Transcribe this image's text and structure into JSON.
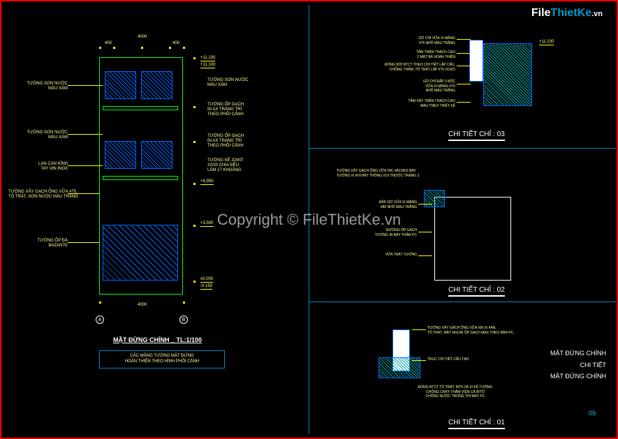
{
  "watermark": {
    "file": "File",
    "thietke": "ThietKe",
    "vn": ".vn",
    "center": "Copyright © FileThietKe.vn"
  },
  "elevation": {
    "title": "MẶT ĐỨNG CHÍNH _ TL:1/100",
    "note": "CÁC MẢNG TƯỜNG MẶT ĐỨNG\nHOÀN THIỆN THEO HÌNH PHỐI CẢNH",
    "labels": {
      "l1": "TƯỜNG SƠN NƯỚC\nMÀU XÁM",
      "l2": "TƯỜNG SƠN NƯỚC\nMÀU XÁM",
      "l3": "LAN CAN KÍNH\nTAY VỊN INOX",
      "l4": "TƯỜNG XÂY GẠCH ỐNG VỮA #75,\nTÔ TRÁT, SƠN NƯỚC MÀU TRẮNG",
      "l5": "TƯỜNG ỐP ĐÁ\nBAZANTE",
      "r1": "TƯỜNG SƠN NƯỚC\nMÀU XÁM",
      "r2": "TƯỜNG ỐP GẠCH\nIN AX TRANG TRÍ\nTHEO PHỐI CẢNH",
      "r3": "TƯỜNG ỐP GẠCH\nIN AX TRANG TRÍ\nTHEO PHỐI CẢNH",
      "r4": "TƯỜNG KẺ JOINT\n20/20 CHIA ĐỀU\nLÀM 17 KHOẢNG"
    },
    "levels": {
      "top": "+11.100",
      "l2": "+11.100",
      "l3": "+6.950",
      "l4": "+3.500",
      "ground": "±0.000",
      "sub": "-0.150"
    },
    "dims": {
      "top1": "400",
      "top2": "4000",
      "top3": "400",
      "bot": "4000",
      "grid_a": "A",
      "grid_b": "B"
    }
  },
  "details": {
    "d1_title": "CHI TIẾT CHỈ : 01",
    "d2_title": "CHI TIẾT CHỈ : 02",
    "d3_title": "CHI TIẾT CHỈ : 03",
    "d3": {
      "n1": "GỜ CHỈ VỮA XI MĂNG\n#75 NHÔ MÀU TRẮNG",
      "n2": "TẤM TRẦN THẠCH CAO\n2 MẶT BẢ HOÀN THIỆN",
      "n3": "ĐÓNG BỜI BTCT THEO CHI TIẾT LẮP CẤU.\nCHỐNG THẤM, TÔ TRÁT LẮP #75 XOXO",
      "n4": "GỜ CHỈ ĐẮP 3 BỘC\nVỮA XI MĂNG #75\nNHÔ MÀU TRẮNG",
      "n5": "TẤM XÂY TRẦN THẠCH CAO\nMÀU THEO THIẾT KẾ",
      "lv": "+11.100"
    },
    "d2": {
      "n1": "TƯỜNG XÂY GẠCH ỐNG VỮA XM. #ACHES BAY\nTƯỜNG XI M KHẢY THÔNG XOI THƯỚC TRÁNG 3",
      "n2": "ĐẮP GỜ VỮA XI MĂNG\n#80 NHÔ MÀU TRẮNG",
      "n3": "ĐƯỜNG ỐP GẠCH\nTƯỜNG IN BẢY TRẦN PC",
      "n4": "VỮA TRÁT TƯỜNG"
    },
    "d1": {
      "n1": "TƯỜNG XÂY GẠCH ỐNG VỮA XM XI #AN,\nTÔ TRÁT, MẶT NGOÀI ỐP GẠCH MAX THEO BẢN PC",
      "n2": "TRỤC CHI TIẾT CẤU TẠO",
      "n3": "ĐÓNG BTCT TÔ TRÁT, MT5 DA XI KẾ TƯỜNG\nCHỐNG CHẢY THẤM VIÊN CẢ B/TỒ\nCHỐNG NƯỚC TRONG THI MÁY PC"
    }
  },
  "side": {
    "t1": "MẶT ĐỨNG CHÍNH",
    "t2": "CHI TIẾT",
    "t3": "MẶT ĐỨNG CHÍNH"
  },
  "page": "09"
}
